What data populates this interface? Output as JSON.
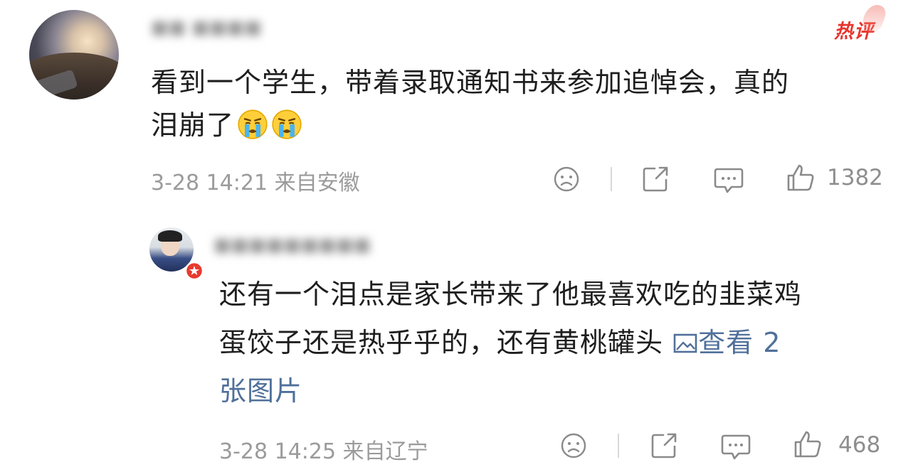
{
  "badge": {
    "hot_label": "热评"
  },
  "comment": {
    "text_line1": "看到一个学生，带着录取通知书来参加追悼会，真的",
    "text_line2": "泪崩了",
    "meta": "3-28 14:21 来自安徽",
    "like_count": "1382",
    "emoji": "loudly-crying-face"
  },
  "reply": {
    "text_line1": "还有一个泪点是家长带来了他最喜欢吃的韭菜鸡",
    "text_line2_prefix": "蛋饺子还是热乎乎的，还有黄桃罐头",
    "view_images_part1": "查看 2",
    "view_images_part2": "张图片",
    "meta": "3-28 14:25 来自辽宁",
    "like_count": "468"
  },
  "icons": {
    "dislike": "sad-face-icon",
    "share": "share-icon",
    "reply": "comment-bubble-icon",
    "like": "thumbs-up-icon",
    "image": "image-icon",
    "verified": "red-star-badge-icon"
  },
  "colors": {
    "hot_badge": "#e8342c",
    "link": "#50709a",
    "meta": "#9b9b9b"
  }
}
